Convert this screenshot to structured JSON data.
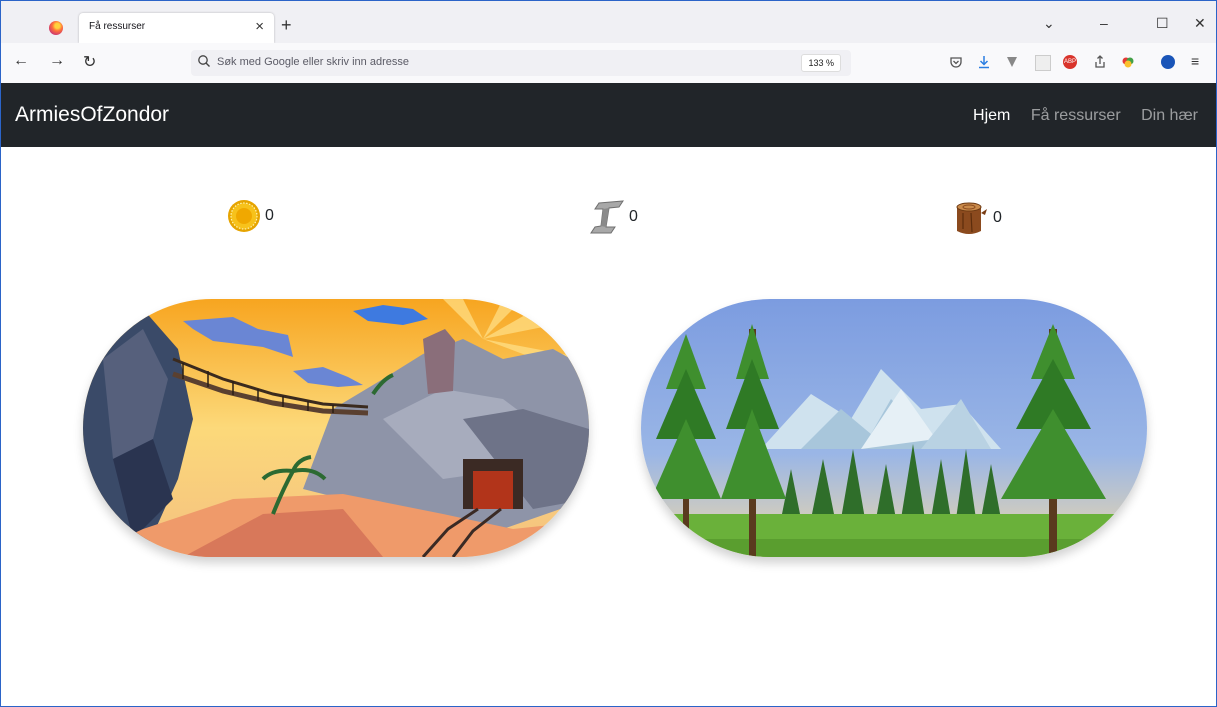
{
  "browser": {
    "tab_title": "Få ressurser",
    "tab_close": "×",
    "new_tab": "+",
    "url_placeholder": "Søk med Google eller skriv inn adresse",
    "zoom": "133 %"
  },
  "app": {
    "brand": "ArmiesOfZondor",
    "nav": [
      "Hjem",
      "Få ressurser",
      "Din hær"
    ],
    "active_nav": "Hjem"
  },
  "resources": [
    {
      "icon": "gold-coin-icon",
      "value": "0"
    },
    {
      "icon": "iron-beam-icon",
      "value": "0"
    },
    {
      "icon": "wood-log-icon",
      "value": "0"
    }
  ],
  "cards": [
    {
      "icon": "mine-scene-image"
    },
    {
      "icon": "forest-scene-image"
    }
  ],
  "colors": {
    "appnav_bg": "#212529",
    "frame_border": "#2b64c8"
  }
}
